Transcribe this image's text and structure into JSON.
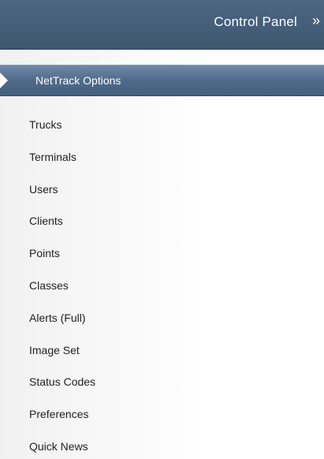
{
  "header": {
    "title": "Control Panel",
    "collapse_glyph": "»"
  },
  "section": {
    "label": "NetTrack Options",
    "arrow_icon": "triangle-right-icon"
  },
  "menu": {
    "items": [
      {
        "label": "Trucks"
      },
      {
        "label": "Terminals"
      },
      {
        "label": "Users"
      },
      {
        "label": "Clients"
      },
      {
        "label": "Points"
      },
      {
        "label": "Classes"
      },
      {
        "label": "Alerts (Full)"
      },
      {
        "label": "Image Set"
      },
      {
        "label": "Status Codes"
      },
      {
        "label": "Preferences"
      },
      {
        "label": "Quick News"
      }
    ]
  },
  "colors": {
    "header_bg": "#44607c",
    "section_bg": "#577290",
    "text": "#222222",
    "header_text": "#ffffff"
  }
}
